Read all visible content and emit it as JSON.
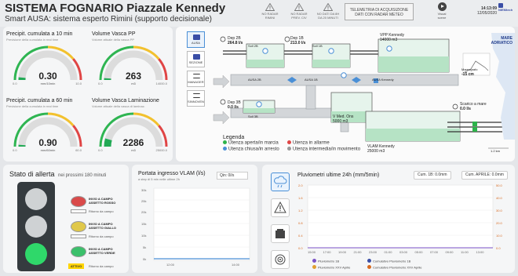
{
  "header": {
    "title": "SISTEMA FOGNARIO Piazzale Kennedy",
    "subtitle": "Smart AUSA: sistema esperto Rimini (supporto decisionale)",
    "warnings": [
      {
        "l1": "NO RADAR",
        "l2": "RIMINI"
      },
      {
        "l1": "NO RADAR",
        "l2": "PREV. CIV"
      },
      {
        "l1": "NO DATI DA 8H",
        "l2": "DA 20 MINUTI"
      }
    ],
    "telemetry": [
      "TELEMETRIA DI ACQUISIZIONE",
      "DATI CON RADAR METEO"
    ],
    "view_label1": "Visual",
    "view_label2": "scene",
    "time": "14:13:09",
    "date": "12/05/2020",
    "logo": "NIEMtech"
  },
  "gauges": [
    {
      "title": "Precipit. cumulata a 10 min",
      "subtitle": "Previsione della cumulata in real time",
      "value": "0.30",
      "unit": "mm/10min",
      "min": "0.0",
      "max": "10.0",
      "fraction": 0.03,
      "color": "#22aa55"
    },
    {
      "title": "Volume Vasca PP",
      "subtitle": "Volume attuale della vasca PP",
      "value": "263",
      "unit": "m3",
      "min": "0.0",
      "max": "14000.0",
      "fraction": 0.02,
      "color": "#22aa55"
    },
    {
      "title": "Precipit. cumulata a 60 min",
      "subtitle": "Previsione della cumulata in real time",
      "value": "0.90",
      "unit": "mm/60min",
      "min": "0.0",
      "max": "60.0",
      "fraction": 0.02,
      "color": "#22aa55"
    },
    {
      "title": "Volume Vasca Laminazione",
      "subtitle": "Volume attuale della vasca di laminaz.",
      "value": "2286",
      "unit": "m3",
      "min": "0.0",
      "max": "25000.0",
      "fraction": 0.09,
      "color": "#22aa55"
    }
  ],
  "nav": [
    {
      "label": "AUSA",
      "active": true
    },
    {
      "label": "SEZIONE",
      "active": false
    },
    {
      "label": "MANAGER",
      "active": false
    },
    {
      "label": "SINNOVEN",
      "active": false
    }
  ],
  "diagram": {
    "dep2b": [
      "Dep 2B",
      "264.8 l/s"
    ],
    "dep1b": [
      "Dep 1B",
      "213.0 l/s"
    ],
    "dep3b": [
      "Dep 3B",
      "0.0 l/s"
    ],
    "vpp": [
      "VPP Kennedy",
      "14000 m3"
    ],
    "vmed": [
      "V Med. Ons",
      "5000 m3"
    ],
    "vlam": [
      "VLAM Kennedy",
      "25000 m3"
    ],
    "ausa2b": "AUSA 2B",
    "ausa1b": "AUSA 1B",
    "ausakennedy": "AUSA Kennedy",
    "sollev": "Soll 2B",
    "sollev1": "Soll 1B",
    "sollev3": "Soll 3B",
    "mare": [
      "MARE",
      "ADRIATICO"
    ],
    "mareografo": [
      "Mareografo",
      "-15 cm"
    ],
    "scarico": [
      "Scarico a mare",
      "0.0 l/s"
    ],
    "km": "1.2 km",
    "legend_title": "Legenda",
    "legend": [
      {
        "label": "Utenza aperta/in marcia",
        "color": "#2db34a"
      },
      {
        "label": "Utenza in allarme",
        "color": "#e04545"
      },
      {
        "label": "Utenza chiusa/in arresto",
        "color": "#4a8fd6"
      },
      {
        "label": "Utenza intermedia/in movimento",
        "color": "#999999"
      }
    ]
  },
  "allerta": {
    "title": "Stato di allerta",
    "subtitle": "nei prossimi 180 minuti",
    "levels": [
      {
        "line1": "INVIO A CAMPO",
        "line2": "ASSETTO ROSSO",
        "back": "Ritorno da campo",
        "color": "#d94a4a"
      },
      {
        "line1": "INVIO A CAMPO",
        "line2": "ASSETTO GIALLO",
        "back": "Ritorno da campo",
        "color": "#e0c84a"
      },
      {
        "line1": "INVIO A CAMPO",
        "line2": "ASSETTO VERDE",
        "back": "Ritorno da campo",
        "color": "#3bc06b"
      }
    ],
    "active_label": "ATTIVO"
  },
  "portata": {
    "title": "Portata ingresso VLAM (l/s)",
    "subtitle": "a step di 5 min nelle ultime 2h",
    "qin": "Qin: 0l/s",
    "yticks": [
      "30k",
      "25k",
      "20k",
      "15k",
      "10k",
      "5k",
      "0k"
    ],
    "xticks": [
      "12:00",
      "14:00"
    ]
  },
  "pluvio": {
    "title": "Pluviometri ultime 24h (mm/5min)",
    "cum1": "Cum. 1B: 0.0mm",
    "cum2": "Cum. APRILE: 0.0mm",
    "yleft": [
      "2.0",
      "1.6",
      "1.2",
      "0.8",
      "0.4",
      "0.0"
    ],
    "yright": [
      "50.0",
      "40.0",
      "30.0",
      "20.0",
      "10.0",
      "0.0"
    ],
    "xticks": [
      "15:00",
      "17:00",
      "19:00",
      "21:00",
      "23:00",
      "01:00",
      "03:00",
      "05:00",
      "07:00",
      "09:00",
      "11:00",
      "13:00"
    ],
    "legend": [
      {
        "label": "Pluviometro 1B",
        "color": "#7b52c7"
      },
      {
        "label": "Cumulativo Pluviometro 1B",
        "color": "#3a4ea6"
      },
      {
        "label": "Pluviometro XXV Aprile",
        "color": "#e0a030"
      },
      {
        "label": "Cumulativo Pluviometro XXV Aprile",
        "color": "#d86a20"
      }
    ]
  }
}
